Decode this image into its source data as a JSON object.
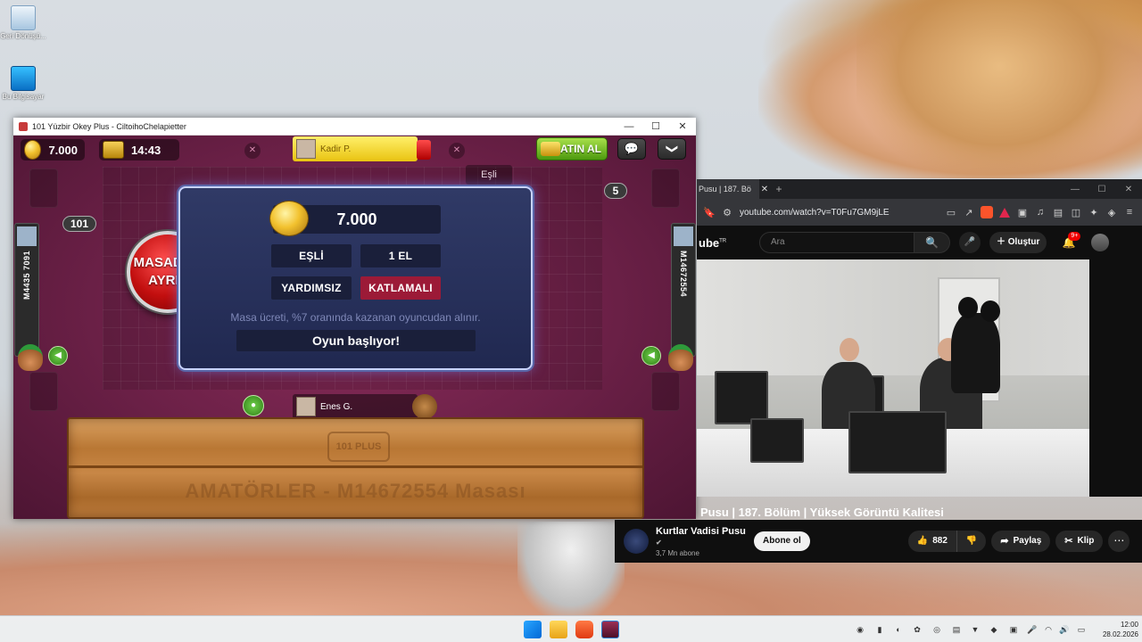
{
  "desktop": {
    "icons": [
      {
        "label": "Geri Dönüşü..."
      },
      {
        "label": "Bu Bilgisayar"
      }
    ]
  },
  "game_window": {
    "title": "101 Yüzbir Okey Plus - CiltoihoChelapietter",
    "controls": {
      "minimize": "—",
      "maximize": "☐",
      "close": "✕"
    },
    "hud": {
      "coins": "7.000",
      "timer": "14:43",
      "buy_label": "SATIN AL",
      "chat_icon": "💬",
      "menu_icon": "❯"
    },
    "players": {
      "top": "Kadir P.",
      "bottom": "Enes G.",
      "left_id": "M4435 7091",
      "right_id": "M14672554"
    },
    "badges": {
      "left_count": "101",
      "right_count": "5",
      "partner_tag": "Eşli"
    },
    "leave_button": {
      "line1": "MASADAN",
      "line2": "AYRIL"
    },
    "dialog": {
      "amount": "7.000",
      "tags": [
        "EŞLİ",
        "1 EL",
        "YARDIMSIZ",
        "KATLAMALI"
      ],
      "note": "Masa ücreti, %7 oranında kazanan oyuncudan alınır.",
      "status": "Oyun başlıyor!"
    },
    "rack": {
      "logo": "101 PLUS",
      "text": "AMATÖRLER - M14672554 Masası"
    }
  },
  "browser": {
    "tab_label": "Pusu | 187. Bö",
    "tab_close": "✕",
    "new_tab": "+",
    "url": "youtube.com/watch?v=T0Fu7GM9jLE",
    "youtube": {
      "logo": "ube",
      "logo_tm": "TR",
      "search_placeholder": "Ara",
      "create_label": "Oluştur",
      "notif_badge": "9+",
      "video_title": "Pusu | 187. Bölüm | Yüksek Görüntü Kalitesi",
      "channel_name": "Kurtlar Vadisi Pusu",
      "channel_verified": "✔",
      "channel_subs": "3,7 Mn abone",
      "subscribe_label": "Abone ol",
      "likes": "882",
      "share_label": "Paylaş",
      "clip_label": "Klip",
      "more": "⋯"
    }
  },
  "taskbar": {
    "time": "12:00",
    "date": "28.02.2026"
  }
}
